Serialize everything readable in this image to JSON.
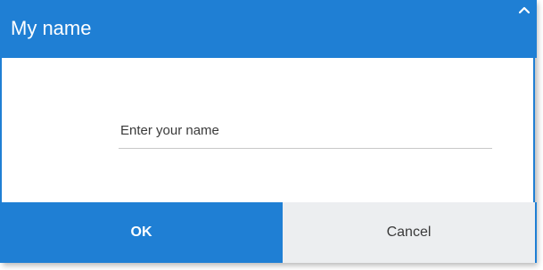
{
  "dialog": {
    "title": "My name",
    "collapse_icon": "chevron-up-icon",
    "name_field": {
      "value": "",
      "placeholder": "Enter your name"
    },
    "ok_label": "OK",
    "cancel_label": "Cancel"
  },
  "colors": {
    "accent": "#1f7fd4",
    "secondary_button_bg": "#eceef0",
    "text_on_accent": "#ffffff"
  }
}
